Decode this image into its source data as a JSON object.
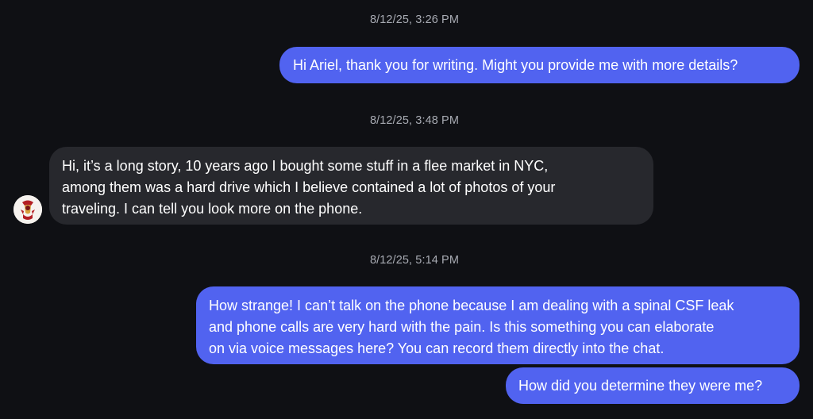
{
  "colors": {
    "background": "#0f1014",
    "outgoing_bubble": "#5163f0",
    "incoming_bubble": "#27282d",
    "timestamp_text": "#a8abb3"
  },
  "messages": {
    "ts1": "8/12/25, 3:26 PM",
    "msg1": {
      "lines": [
        "Hi Ariel, thank you for writing. Might you provide me with more details?"
      ]
    },
    "ts2": "8/12/25, 3:48 PM",
    "msg2": {
      "lines": [
        "Hi, it’s a long story, 10 years ago I bought some stuff in a flee market in NYC,",
        "among them was a hard drive which I believe contained a lot of photos of your",
        "traveling. I can tell you look more on the phone."
      ]
    },
    "ts3": "8/12/25, 5:14 PM",
    "msg3": {
      "lines": [
        "How strange! I can’t talk on the phone because I am dealing with a spinal CSF leak",
        "and phone calls are very hard with the pain. Is this something you can elaborate",
        "on via voice messages here? You can record them directly into the chat."
      ]
    },
    "msg4": {
      "lines": [
        "How did you determine they were me?"
      ]
    }
  },
  "contact": {
    "avatar_icon": "contact-avatar-icon"
  }
}
